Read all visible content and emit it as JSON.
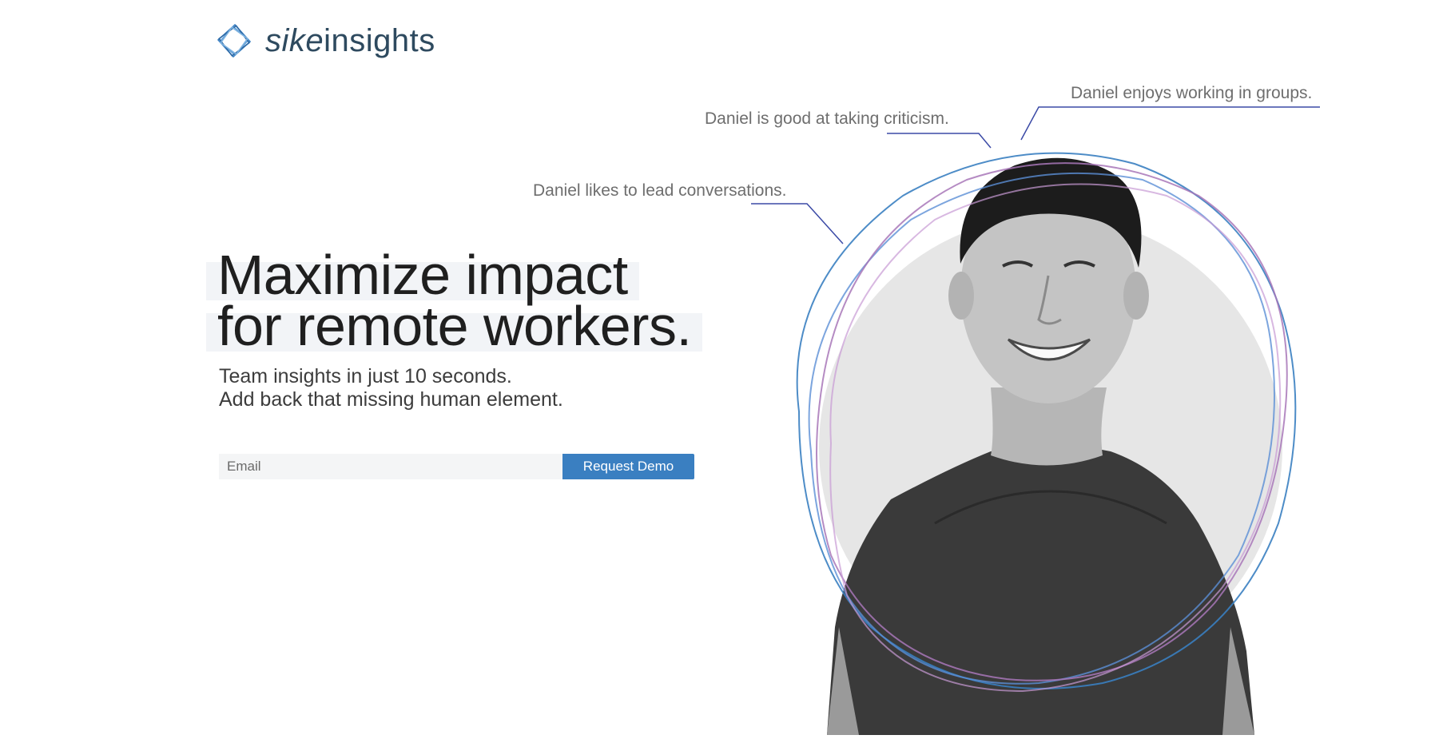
{
  "brand": {
    "name_italic": "sike",
    "name_rest": "insights",
    "logo_color": "#3a7fc1"
  },
  "hero": {
    "title_line1": "Maximize impact",
    "title_line2": "for remote workers.",
    "subtitle_line1": "Team insights in just 10 seconds.",
    "subtitle_line2": "Add back that missing human element."
  },
  "form": {
    "email_placeholder": "Email",
    "email_value": "",
    "button_label": "Request Demo",
    "button_color": "#3a7fc1"
  },
  "annotations": [
    "Daniel enjoys working in groups.",
    "Daniel is good at taking criticism.",
    "Daniel likes to lead conversations."
  ],
  "colors": {
    "annotation_line": "#3b4aa6",
    "ring_blue": "#3a7fc1",
    "ring_purple": "#a877b8",
    "circle_fill": "#e6e6e6"
  }
}
